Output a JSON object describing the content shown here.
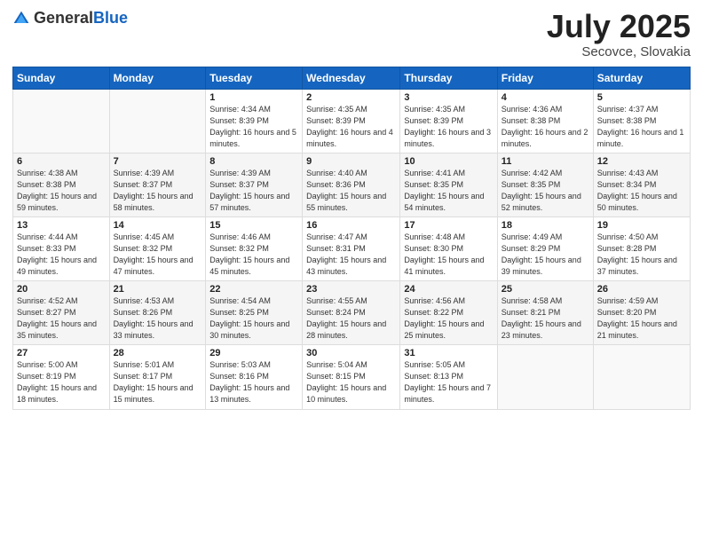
{
  "logo": {
    "general": "General",
    "blue": "Blue"
  },
  "title": "July 2025",
  "subtitle": "Secovce, Slovakia",
  "days_header": [
    "Sunday",
    "Monday",
    "Tuesday",
    "Wednesday",
    "Thursday",
    "Friday",
    "Saturday"
  ],
  "weeks": [
    [
      {
        "day": "",
        "sunrise": "",
        "sunset": "",
        "daylight": ""
      },
      {
        "day": "",
        "sunrise": "",
        "sunset": "",
        "daylight": ""
      },
      {
        "day": "1",
        "sunrise": "Sunrise: 4:34 AM",
        "sunset": "Sunset: 8:39 PM",
        "daylight": "Daylight: 16 hours and 5 minutes."
      },
      {
        "day": "2",
        "sunrise": "Sunrise: 4:35 AM",
        "sunset": "Sunset: 8:39 PM",
        "daylight": "Daylight: 16 hours and 4 minutes."
      },
      {
        "day": "3",
        "sunrise": "Sunrise: 4:35 AM",
        "sunset": "Sunset: 8:39 PM",
        "daylight": "Daylight: 16 hours and 3 minutes."
      },
      {
        "day": "4",
        "sunrise": "Sunrise: 4:36 AM",
        "sunset": "Sunset: 8:38 PM",
        "daylight": "Daylight: 16 hours and 2 minutes."
      },
      {
        "day": "5",
        "sunrise": "Sunrise: 4:37 AM",
        "sunset": "Sunset: 8:38 PM",
        "daylight": "Daylight: 16 hours and 1 minute."
      }
    ],
    [
      {
        "day": "6",
        "sunrise": "Sunrise: 4:38 AM",
        "sunset": "Sunset: 8:38 PM",
        "daylight": "Daylight: 15 hours and 59 minutes."
      },
      {
        "day": "7",
        "sunrise": "Sunrise: 4:39 AM",
        "sunset": "Sunset: 8:37 PM",
        "daylight": "Daylight: 15 hours and 58 minutes."
      },
      {
        "day": "8",
        "sunrise": "Sunrise: 4:39 AM",
        "sunset": "Sunset: 8:37 PM",
        "daylight": "Daylight: 15 hours and 57 minutes."
      },
      {
        "day": "9",
        "sunrise": "Sunrise: 4:40 AM",
        "sunset": "Sunset: 8:36 PM",
        "daylight": "Daylight: 15 hours and 55 minutes."
      },
      {
        "day": "10",
        "sunrise": "Sunrise: 4:41 AM",
        "sunset": "Sunset: 8:35 PM",
        "daylight": "Daylight: 15 hours and 54 minutes."
      },
      {
        "day": "11",
        "sunrise": "Sunrise: 4:42 AM",
        "sunset": "Sunset: 8:35 PM",
        "daylight": "Daylight: 15 hours and 52 minutes."
      },
      {
        "day": "12",
        "sunrise": "Sunrise: 4:43 AM",
        "sunset": "Sunset: 8:34 PM",
        "daylight": "Daylight: 15 hours and 50 minutes."
      }
    ],
    [
      {
        "day": "13",
        "sunrise": "Sunrise: 4:44 AM",
        "sunset": "Sunset: 8:33 PM",
        "daylight": "Daylight: 15 hours and 49 minutes."
      },
      {
        "day": "14",
        "sunrise": "Sunrise: 4:45 AM",
        "sunset": "Sunset: 8:32 PM",
        "daylight": "Daylight: 15 hours and 47 minutes."
      },
      {
        "day": "15",
        "sunrise": "Sunrise: 4:46 AM",
        "sunset": "Sunset: 8:32 PM",
        "daylight": "Daylight: 15 hours and 45 minutes."
      },
      {
        "day": "16",
        "sunrise": "Sunrise: 4:47 AM",
        "sunset": "Sunset: 8:31 PM",
        "daylight": "Daylight: 15 hours and 43 minutes."
      },
      {
        "day": "17",
        "sunrise": "Sunrise: 4:48 AM",
        "sunset": "Sunset: 8:30 PM",
        "daylight": "Daylight: 15 hours and 41 minutes."
      },
      {
        "day": "18",
        "sunrise": "Sunrise: 4:49 AM",
        "sunset": "Sunset: 8:29 PM",
        "daylight": "Daylight: 15 hours and 39 minutes."
      },
      {
        "day": "19",
        "sunrise": "Sunrise: 4:50 AM",
        "sunset": "Sunset: 8:28 PM",
        "daylight": "Daylight: 15 hours and 37 minutes."
      }
    ],
    [
      {
        "day": "20",
        "sunrise": "Sunrise: 4:52 AM",
        "sunset": "Sunset: 8:27 PM",
        "daylight": "Daylight: 15 hours and 35 minutes."
      },
      {
        "day": "21",
        "sunrise": "Sunrise: 4:53 AM",
        "sunset": "Sunset: 8:26 PM",
        "daylight": "Daylight: 15 hours and 33 minutes."
      },
      {
        "day": "22",
        "sunrise": "Sunrise: 4:54 AM",
        "sunset": "Sunset: 8:25 PM",
        "daylight": "Daylight: 15 hours and 30 minutes."
      },
      {
        "day": "23",
        "sunrise": "Sunrise: 4:55 AM",
        "sunset": "Sunset: 8:24 PM",
        "daylight": "Daylight: 15 hours and 28 minutes."
      },
      {
        "day": "24",
        "sunrise": "Sunrise: 4:56 AM",
        "sunset": "Sunset: 8:22 PM",
        "daylight": "Daylight: 15 hours and 25 minutes."
      },
      {
        "day": "25",
        "sunrise": "Sunrise: 4:58 AM",
        "sunset": "Sunset: 8:21 PM",
        "daylight": "Daylight: 15 hours and 23 minutes."
      },
      {
        "day": "26",
        "sunrise": "Sunrise: 4:59 AM",
        "sunset": "Sunset: 8:20 PM",
        "daylight": "Daylight: 15 hours and 21 minutes."
      }
    ],
    [
      {
        "day": "27",
        "sunrise": "Sunrise: 5:00 AM",
        "sunset": "Sunset: 8:19 PM",
        "daylight": "Daylight: 15 hours and 18 minutes."
      },
      {
        "day": "28",
        "sunrise": "Sunrise: 5:01 AM",
        "sunset": "Sunset: 8:17 PM",
        "daylight": "Daylight: 15 hours and 15 minutes."
      },
      {
        "day": "29",
        "sunrise": "Sunrise: 5:03 AM",
        "sunset": "Sunset: 8:16 PM",
        "daylight": "Daylight: 15 hours and 13 minutes."
      },
      {
        "day": "30",
        "sunrise": "Sunrise: 5:04 AM",
        "sunset": "Sunset: 8:15 PM",
        "daylight": "Daylight: 15 hours and 10 minutes."
      },
      {
        "day": "31",
        "sunrise": "Sunrise: 5:05 AM",
        "sunset": "Sunset: 8:13 PM",
        "daylight": "Daylight: 15 hours and 7 minutes."
      },
      {
        "day": "",
        "sunrise": "",
        "sunset": "",
        "daylight": ""
      },
      {
        "day": "",
        "sunrise": "",
        "sunset": "",
        "daylight": ""
      }
    ]
  ]
}
